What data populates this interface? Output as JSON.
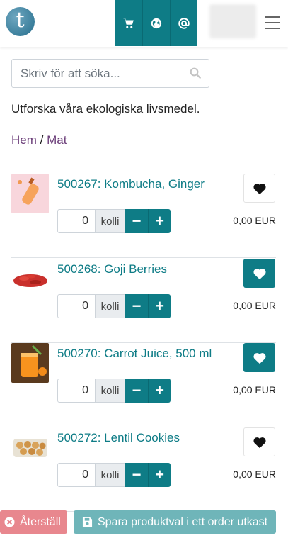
{
  "header": {
    "logo_letter": "t",
    "nav_icons": [
      "cart-icon",
      "globe-icon",
      "at-icon"
    ],
    "menu_icon": "hamburger-icon"
  },
  "search": {
    "placeholder": "Skriv för att söka...",
    "value": ""
  },
  "intro": "Utforska våra ekologiska livsmedel.",
  "breadcrumb": {
    "home": "Hem",
    "separator": "/",
    "current": "Mat"
  },
  "products": [
    {
      "name": "500267: Kombucha, Ginger",
      "qty": "0",
      "unit": "kolli",
      "price": "0,00 EUR",
      "favorite": false
    },
    {
      "name": "500268: Goji Berries",
      "qty": "0",
      "unit": "kolli",
      "price": "0,00 EUR",
      "favorite": true
    },
    {
      "name": "500270: Carrot Juice, 500 ml",
      "qty": "0",
      "unit": "kolli",
      "price": "0,00 EUR",
      "favorite": true
    },
    {
      "name": "500272: Lentil Cookies",
      "qty": "0",
      "unit": "kolli",
      "price": "0,00 EUR",
      "favorite": false
    }
  ],
  "footer": {
    "reset_label": "Återställ",
    "save_label": "Spara produktval i ett order utkast"
  },
  "colors": {
    "accent": "#0e7c86",
    "link": "#6b3e79",
    "reset": "#e8878e",
    "save": "#6fb5b9"
  }
}
